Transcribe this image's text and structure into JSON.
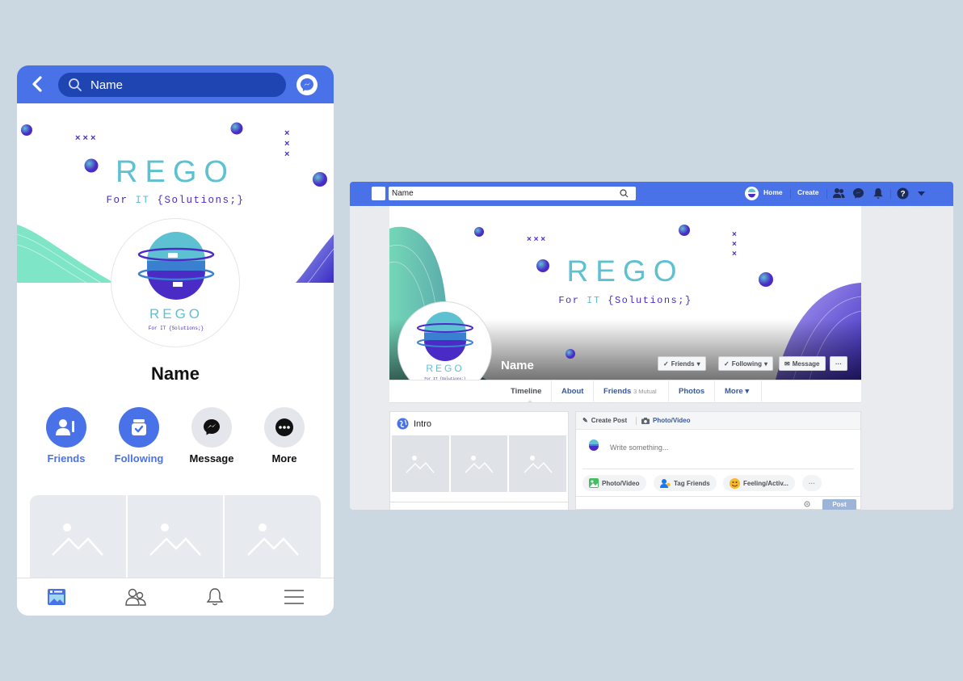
{
  "brand": {
    "title": "REGO",
    "subtitle_pre": "For ",
    "subtitle_it": "IT",
    "subtitle_post": " {Solutions;}",
    "logo_subtitle": "For IT {Solutions;}",
    "colors": {
      "teal": "#5ec1d2",
      "purple": "#4a2bc6",
      "blue": "#4a72e8"
    }
  },
  "mobile": {
    "search": {
      "value": "Name"
    },
    "icons": {
      "back": "chevron-left-icon",
      "messenger": "messenger-icon"
    },
    "profile_name": "Name",
    "actions": [
      {
        "label": "Friends",
        "icon": "friends-icon"
      },
      {
        "label": "Following",
        "icon": "following-icon"
      },
      {
        "label": "Message",
        "icon": "messenger-icon"
      },
      {
        "label": "More",
        "icon": "more-icon"
      }
    ],
    "bottom_nav": [
      "profile-icon",
      "friends-icon",
      "notifications-icon",
      "menu-icon"
    ]
  },
  "desktop": {
    "search": {
      "value": "Name"
    },
    "nav": {
      "home": "Home",
      "create": "Create"
    },
    "profile_name": "Name",
    "buttons": {
      "friends": "Friends",
      "following": "Following",
      "message": "Message",
      "more": "···"
    },
    "tabs": {
      "timeline": "Timeline",
      "about": "About",
      "friends": "Friends",
      "friends_mutual": "3 Mutual",
      "photos": "Photos",
      "more": "More"
    },
    "intro": {
      "title": "Intro"
    },
    "composer": {
      "create_post": "Create Post",
      "photo_video_tab": "Photo/Video",
      "placeholder": "Write something...",
      "photo_video": "Photo/Video",
      "tag_friends": "Tag Friends",
      "feeling": "Feeling/Activ...",
      "more": "···",
      "post": "Post"
    }
  }
}
